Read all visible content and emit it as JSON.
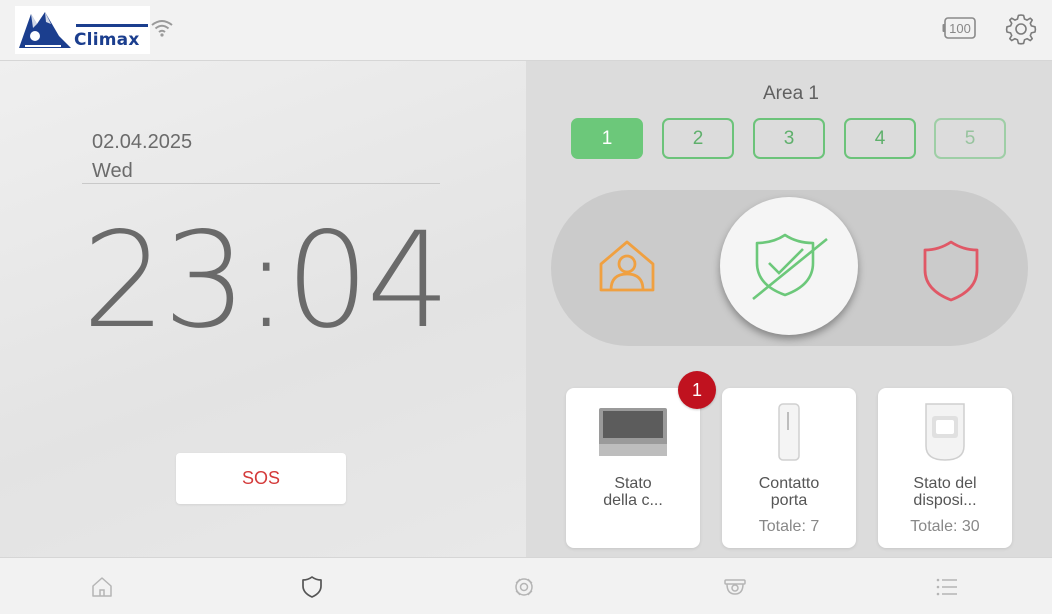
{
  "header": {
    "brand": "Climax",
    "battery_level": "100",
    "icons": {
      "wifi": "wifi-icon",
      "battery": "battery-icon",
      "settings": "gear-icon"
    }
  },
  "left": {
    "date": "02.04.2025",
    "day": "Wed",
    "time_hours": "23",
    "time_separator": ":",
    "time_minutes": "04",
    "sos_label": "SOS"
  },
  "right": {
    "area_title": "Area 1",
    "areas": [
      "1",
      "2",
      "3",
      "4",
      "5"
    ],
    "selected_area": "1",
    "modes": {
      "home": "home-arm-icon",
      "disarm": "disarm-shield-icon",
      "away": "away-arm-shield-icon"
    },
    "cards": [
      {
        "title_line1": "Stato",
        "title_line2": "della c...",
        "total": "",
        "badge": "1"
      },
      {
        "title_line1": "Contatto",
        "title_line2": "porta",
        "total": "Totale: 7"
      },
      {
        "title_line1": "Stato del",
        "title_line2": "disposi...",
        "total": "Totale: 30"
      }
    ]
  },
  "nav": {
    "items": [
      "home-icon",
      "shield-icon",
      "camera-icon",
      "cctv-icon",
      "list-icon"
    ],
    "active": "shield-icon"
  },
  "colors": {
    "accent_green": "#6cc87a",
    "home_orange": "#f0a040",
    "away_red": "#e05866",
    "sos_red": "#d43a3a",
    "badge_red": "#c0121f",
    "brand_blue": "#1b3e8e"
  }
}
